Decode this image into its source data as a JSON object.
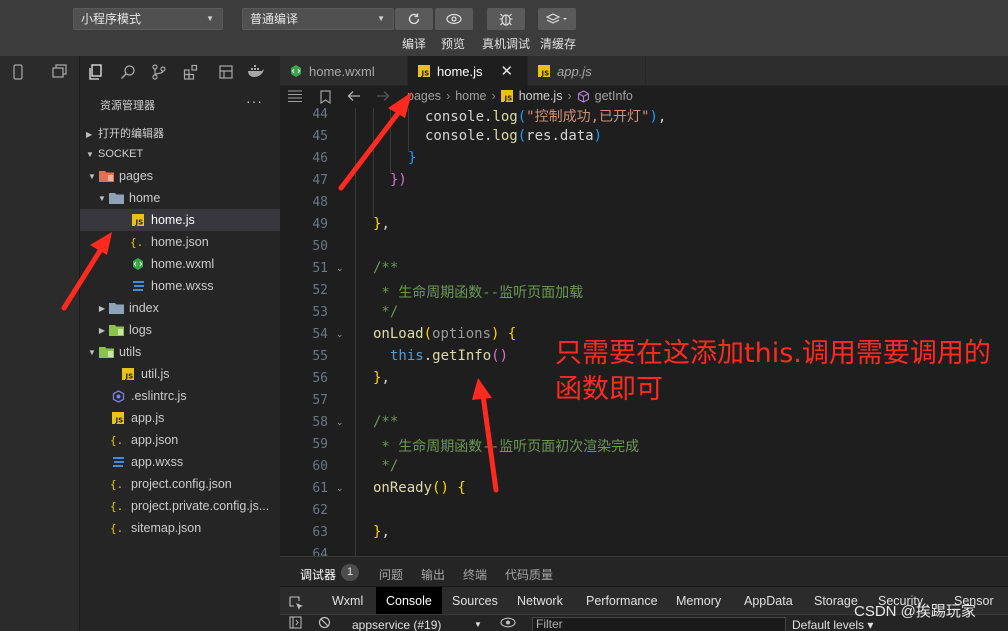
{
  "toolbar": {
    "mode_select": "小程序模式",
    "compile_select": "普通编译",
    "compile_label": "编译",
    "preview_label": "预览",
    "debug_label": "真机调试",
    "clear_cache_label": "清缓存"
  },
  "explorer": {
    "title": "资源管理器",
    "more": "···",
    "open_editors": "打开的编辑器",
    "project": "SOCKET",
    "tree": [
      {
        "name": "pages",
        "type": "folder-red",
        "depth": 1,
        "open": true
      },
      {
        "name": "home",
        "type": "folder",
        "depth": 2,
        "open": true
      },
      {
        "name": "home.js",
        "type": "js",
        "depth": 3,
        "active": true
      },
      {
        "name": "home.json",
        "type": "json",
        "depth": 3
      },
      {
        "name": "home.wxml",
        "type": "wxml",
        "depth": 3
      },
      {
        "name": "home.wxss",
        "type": "wxss",
        "depth": 3
      },
      {
        "name": "index",
        "type": "folder",
        "depth": 2,
        "open": false
      },
      {
        "name": "logs",
        "type": "folder-green",
        "depth": 2,
        "open": false
      },
      {
        "name": "utils",
        "type": "folder-green",
        "depth": 1,
        "open": true
      },
      {
        "name": "util.js",
        "type": "js",
        "depth": 2
      },
      {
        "name": ".eslintrc.js",
        "type": "eslint",
        "depth": 1
      },
      {
        "name": "app.js",
        "type": "js",
        "depth": 1
      },
      {
        "name": "app.json",
        "type": "json",
        "depth": 1
      },
      {
        "name": "app.wxss",
        "type": "wxss",
        "depth": 1
      },
      {
        "name": "project.config.json",
        "type": "json",
        "depth": 1
      },
      {
        "name": "project.private.config.js...",
        "type": "json",
        "depth": 1
      },
      {
        "name": "sitemap.json",
        "type": "json",
        "depth": 1
      }
    ]
  },
  "tabs": [
    {
      "label": "home.wxml",
      "type": "wxml"
    },
    {
      "label": "home.js",
      "type": "js",
      "active": true,
      "close": "✕"
    },
    {
      "label": "app.js",
      "type": "js"
    }
  ],
  "breadcrumb": [
    "pages",
    "home",
    "home.js",
    "getInfo"
  ],
  "editor": {
    "line_numbers": [
      "44",
      "45",
      "46",
      "47",
      "48",
      "49",
      "50",
      "51",
      "52",
      "53",
      "54",
      "55",
      "56",
      "57",
      "58",
      "59",
      "60",
      "61",
      "62",
      "63",
      "64"
    ],
    "tokens": {
      "console": "console.",
      "log": "log",
      "paren_open": "(",
      "paren_close": ")",
      "str_success": "\"控制成功,已开灯\"",
      "comma": ",",
      "res_data": "res.data",
      "brace_close": "}",
      "brace_open": "{",
      "paren_close_line47": "})",
      "block_close_comma": "},",
      "doc_open": "/**",
      "doc_onload": " * 生命周期函数--监听页面加载",
      "doc_close": " */",
      "onload": "onLoad",
      "options": "options",
      "this": "this",
      "dot": ".",
      "getinfo": "getInfo",
      "parens": "()",
      "doc_onready": " * 生命周期函数--监听页面初次渲染完成",
      "onready": "onReady",
      "space": " "
    }
  },
  "annotation": "只需要在这添加this.调用需要调用的函数即可",
  "panel": {
    "tabs": [
      "调试器",
      "问题",
      "输出",
      "终端",
      "代码质量"
    ],
    "badge": "1",
    "devtools_tabs": [
      "Wxml",
      "Console",
      "Sources",
      "Network",
      "Performance",
      "Memory",
      "AppData",
      "Storage",
      "Security",
      "Sensor"
    ],
    "context": "appservice (#19)",
    "filter_placeholder": "Filter",
    "levels": "Default levels ▾"
  },
  "watermark": "CSDN @挨踢玩家",
  "colors": {
    "accent_red": "#ff2a1f",
    "editor_bg": "#1e1e1e"
  }
}
